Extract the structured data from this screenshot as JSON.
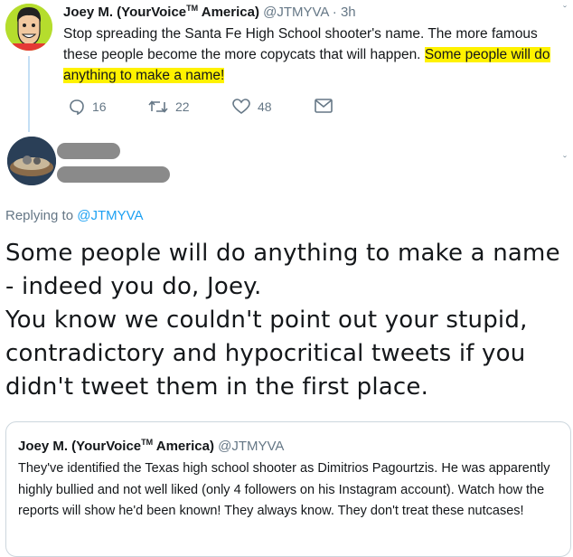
{
  "tweet1": {
    "name": "Joey M. (YourVoice",
    "name_mark": "TM",
    "name_suffix": " America)",
    "handle": "@JTMYVA",
    "dot": "·",
    "time": "3h",
    "text_plain": "Stop spreading the Santa Fe High School shooter's name. The more famous these people become the more copycats that will happen. ",
    "text_highlight": "Some people will do anything to make a name!",
    "replies": "16",
    "retweets": "22",
    "likes": "48",
    "icons": {
      "reply": "reply-icon",
      "retweet": "retweet-icon",
      "like": "heart-icon",
      "dm": "envelope-icon"
    }
  },
  "reply": {
    "replying_prefix": "Replying to ",
    "replying_handle": "@JTMYVA",
    "line1": "Some people will do anything to make a name - indeed you do, Joey.",
    "line2": "You know we couldn't point out your stupid, contradictory and hypocritical tweets if you didn't tweet them in the first place."
  },
  "quote": {
    "name": "Joey M. (YourVoice",
    "name_mark": "TM",
    "name_suffix": " America)",
    "handle": "@JTMYVA",
    "text": "They've identified the Texas high school shooter as Dimitrios Pagourtzis. He was apparently highly bullied and not well liked (only 4 followers on his Instagram account). Watch how the reports will show he'd been known! They always know. They don't treat these nutcases!"
  },
  "colors": {
    "accent": "#1da1f2",
    "highlight": "#fff200",
    "secondary_text": "#657786"
  }
}
